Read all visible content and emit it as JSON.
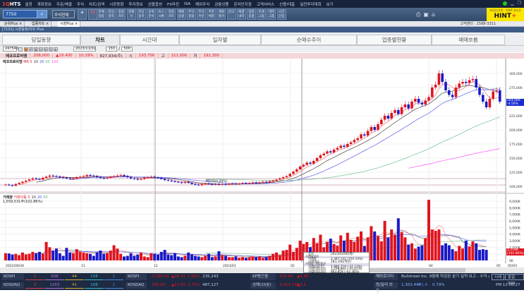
{
  "app": {
    "logo": "HTS",
    "menu": [
      "설정",
      "계좌정보",
      "주문/체결",
      "주식",
      "차트/검색",
      "시장동향",
      "투자정보",
      "선물옵션",
      "FX마진",
      "ISA",
      "해외주식",
      "금융상품",
      "온라인지점",
      "고객서비스",
      "신용/대출",
      "실전투자대회",
      "보기"
    ]
  },
  "toolbar": {
    "search_value": "7750",
    "search_icon": "magnifier-icon",
    "stock_select": "주식현재",
    "buttons": [
      "현재\n종합",
      "관심\n종목",
      "종합\n차트",
      "현재\n가",
      "관심\n종목",
      "순위\n분석",
      "뉴스\n시황",
      "종합\n차트",
      "매매\n동향",
      "주식\n종합",
      "주식\n주문",
      "주문\n체결",
      "계좌\n평가",
      "잔고",
      "체결\n내역",
      "업종\n동향",
      "트랜\n그림",
      "테마\n그룹",
      "시간\n단일"
    ],
    "hint_sub": "외국인/기관 · 이벤트 실시간",
    "hint_main": "HINT",
    "hint_plus": "+"
  },
  "tabs": [
    {
      "label": "순위Plus"
    },
    {
      "label": "업종차트"
    },
    {
      "label": "시장Plus"
    }
  ],
  "customer_center": "고객센터 : 1588-3311",
  "window_title": "[7102] 시장동향/차트 Plus",
  "main_tabs": [
    "당일동향",
    "차트",
    "시간대",
    "일자별",
    "순매수추이",
    "업종별현황",
    "매매흐름"
  ],
  "controls": {
    "code": "247540",
    "date": "2023/11/02",
    "count": "150",
    "total": "500",
    "period_buttons": [
      "일",
      "주",
      "월",
      "년",
      "분",
      "틱",
      "초"
    ]
  },
  "quote": {
    "name": "에코프로비엠",
    "price": "208,000",
    "change": "▲19,400",
    "rate": "10.29%",
    "volume": "827,934(주)",
    "open_label": "시",
    "open": "193,700",
    "high_label": "고",
    "high": "211,000",
    "low_label": "저",
    "low": "192,300"
  },
  "legend_price": {
    "name": "에코프로비엠",
    "ma_label": "MA",
    "periods": [
      "5",
      "10",
      "20",
      "60",
      "120"
    ],
    "colors": [
      "#e03030",
      "#333333",
      "#4a4af0",
      "#5cb87a",
      "#ff44ff"
    ]
  },
  "legend_volume": {
    "name": "거래량",
    "ma_label": "거래이동",
    "periods": [
      "5",
      "10",
      "20",
      "60"
    ],
    "value": "1,559,531주(102.86%)"
  },
  "tooltip": {
    "date_label": "일자",
    "date": "2023/02/06(월)",
    "section1": "거래량차트",
    "rows1": [
      [
        "거래량",
        "2,387,142 (150.33%)"
      ],
      [
        "거래대금",
        "283,106(백만)"
      ]
    ],
    "section2": "거래량 이동평균",
    "rows2": [
      [
        "거래이동[5]",
        "1,880,719 (-21.13%)"
      ],
      [
        "거래이동[10]",
        "1,298,860 (-45.65%)"
      ],
      [
        "거래이동[20]",
        "863,858 (-63.38%)"
      ],
      [
        "거래이동[60]",
        "839,543 (-64.98%)"
      ]
    ]
  },
  "price_tag": {
    "value": "244,000",
    "rate": "-4.56%"
  },
  "volume_tag": {
    "value": "1,559K",
    "rate": "(102.86%)"
  },
  "annotation": "배당락(0.00%)",
  "chart_data": {
    "type": "candlestick",
    "price_axis": [
      "300,000",
      "275,000",
      "250,000",
      "225,000",
      "200,000",
      "175,000",
      "150,000",
      "125,000",
      "100,000"
    ],
    "volume_axis": [
      "9,000K",
      "8,000K",
      "7,000K",
      "6,000K",
      "5,000K",
      "4,000K",
      "3,000K",
      "2,000K",
      "1,000K",
      "0K"
    ],
    "date_labels": [
      "2022/09/30",
      "11",
      "12",
      "2023/01",
      "02",
      "04",
      "05"
    ],
    "last_date": "05/03",
    "close_thousands": [
      103,
      102,
      101,
      104,
      106,
      108,
      110,
      112,
      114,
      113,
      112,
      115,
      117,
      119,
      118,
      117,
      116,
      115,
      114,
      113,
      114,
      116,
      117,
      118,
      120,
      119,
      118,
      116,
      115,
      114,
      115,
      117,
      118,
      119,
      120,
      118,
      116,
      114,
      113,
      112,
      113,
      115,
      116,
      117,
      116,
      115,
      113,
      111,
      110,
      109,
      108,
      107,
      106,
      108,
      106,
      104,
      103,
      102,
      104,
      105,
      104,
      103,
      104,
      103,
      104,
      103,
      104,
      105,
      104,
      105,
      106,
      105,
      106,
      107,
      106,
      107,
      108,
      107,
      109,
      110,
      112,
      114,
      116,
      118,
      122,
      126,
      130,
      135,
      138,
      142,
      140,
      145,
      150,
      155,
      158,
      162,
      160,
      165,
      168,
      172,
      170,
      175,
      178,
      182,
      185,
      192,
      190,
      198,
      205,
      200,
      210,
      218,
      225,
      220,
      230,
      235,
      228,
      240,
      245,
      238,
      250,
      255,
      248,
      245,
      252,
      258,
      275,
      280,
      300,
      285,
      270,
      262,
      258,
      275,
      282,
      285,
      283,
      288,
      290,
      275,
      262,
      250,
      240,
      255,
      268,
      270,
      250
    ],
    "volume_k": [
      1100,
      1050,
      900,
      1000,
      800,
      1200,
      900,
      1000,
      1300,
      1100,
      1300,
      1000,
      2800,
      2000,
      1500,
      1800,
      1100,
      700,
      1900,
      1200,
      1100,
      1700,
      1300,
      1200,
      1100,
      1000,
      700,
      1200,
      1500,
      1000,
      1100,
      1500,
      2300,
      1800,
      1000,
      600,
      700,
      1100,
      700,
      900,
      1200,
      600,
      500,
      1100,
      1000,
      900,
      1300,
      1600,
      900,
      800,
      1100,
      600,
      500,
      700,
      1200,
      900,
      700,
      600,
      500,
      700,
      1000,
      500,
      600,
      1400,
      800,
      700,
      500,
      500,
      600,
      400,
      500,
      400,
      500,
      600,
      500,
      600,
      400,
      500,
      700,
      1000,
      1200,
      800,
      1500,
      1600,
      2400,
      1300,
      1900,
      3000,
      2500,
      2800,
      2000,
      3400,
      2600,
      3900,
      2000,
      2800,
      3300,
      2500,
      2200,
      3800,
      3000,
      4200,
      3100,
      2800,
      3600,
      4400,
      2200,
      3500,
      5200,
      4400,
      3700,
      2900,
      6000,
      3500,
      4700,
      3900,
      6400,
      4300,
      3500,
      2400,
      2600,
      1800,
      2100,
      2300,
      3400,
      9200,
      4700,
      4500,
      4700,
      2300,
      2600,
      2300,
      1700,
      1400,
      2200,
      1800,
      3000,
      2100,
      2900,
      2600,
      1600,
      1700,
      1600
    ]
  },
  "status": {
    "rows": [
      {
        "index": "KOSPI",
        "counts": [
          "1",
          "608",
          "44",
          "158",
          "1"
        ],
        "quote_name": "KOSPI",
        "quote": "2,339.60",
        "change": "▲38.32",
        "rate": "1.66%",
        "amount": "235,243",
        "label2": "KP범근월",
        "value2": "315.90",
        "change2": "▲4.85",
        "label3": "해외로이터",
        "news": "Bullstreet Inc. 9월에 마감된 분기 실적 보고 - 수익 순",
        "btn1": "시세",
        "btn2": "발걸999"
      },
      {
        "index": "KOSDAQ",
        "counts": [
          "2",
          "1263",
          "41",
          "108",
          "1"
        ],
        "quote_name": "KOSDAQ",
        "quote": "766.92",
        "change": "▲27.69",
        "rate": "3.75%",
        "amount": "487,127",
        "label2": "상해(15분)",
        "value2": "3,023.716",
        "change2": "▲0.6",
        "label3": "원/달러 외환",
        "fx": "1,303.44",
        "fx_change": "▼1.4",
        "fx_rate": "0.79%",
        "time": "PM 12:06:27"
      }
    ],
    "count_colors": [
      "#e0414a",
      "#b070e0",
      "#e0b030",
      "#30c0d0",
      "#4a8ae0"
    ]
  }
}
